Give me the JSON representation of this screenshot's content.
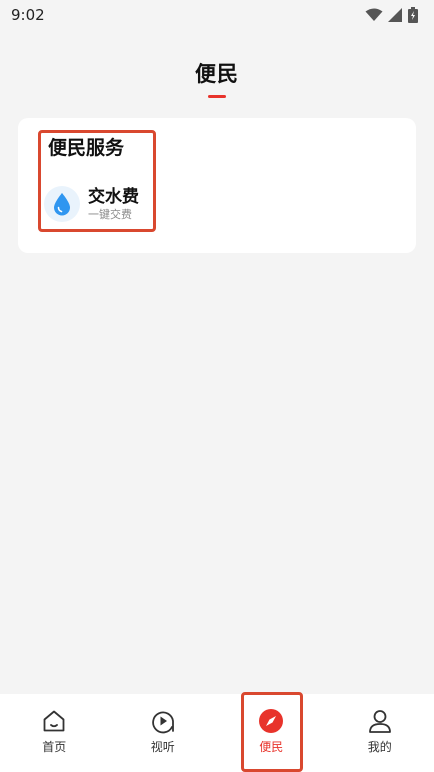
{
  "status_bar": {
    "time": "9:02",
    "icons": [
      "wifi-icon",
      "signal-icon",
      "battery-icon"
    ]
  },
  "header": {
    "title": "便民",
    "accent_color": "#e8332b"
  },
  "service_section": {
    "title": "便民服务",
    "items": [
      {
        "name": "交水费",
        "subtitle": "一键交费",
        "icon": "water-drop-icon"
      }
    ]
  },
  "bottom_nav": {
    "items": [
      {
        "label": "首页",
        "icon": "home-icon",
        "active": false
      },
      {
        "label": "视听",
        "icon": "play-icon",
        "active": false
      },
      {
        "label": "便民",
        "icon": "compass-icon",
        "active": true
      },
      {
        "label": "我的",
        "icon": "user-icon",
        "active": false
      }
    ]
  },
  "colors": {
    "background": "#f4f4f4",
    "card": "#ffffff",
    "highlight_border": "#d9482f",
    "water_blue": "#2f96f0"
  }
}
